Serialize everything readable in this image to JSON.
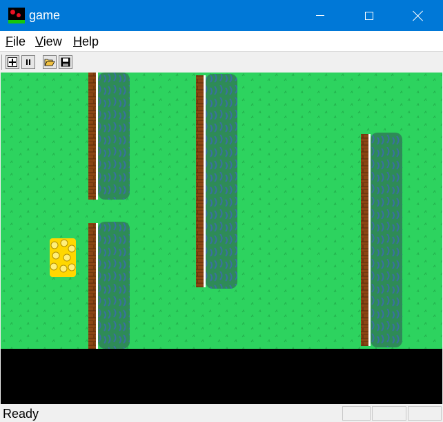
{
  "window": {
    "title": "game",
    "icon": "game-app-icon"
  },
  "menu": {
    "file": {
      "accel": "F",
      "rest": "ile"
    },
    "view": {
      "accel": "V",
      "rest": "iew"
    },
    "help": {
      "accel": "H",
      "rest": "elp"
    }
  },
  "toolbar": {
    "buttons": [
      {
        "name": "new-game-button",
        "icon": "plus-square-icon"
      },
      {
        "name": "pause-button",
        "icon": "pause-icon"
      },
      {
        "name": "open-button",
        "icon": "folder-open-icon"
      },
      {
        "name": "save-button",
        "icon": "floppy-disk-icon"
      }
    ]
  },
  "game": {
    "colors": {
      "grass": "#2dd35f",
      "pipe_wall": "#8b4513",
      "pipe_highlight": "#ffffff",
      "hedge": "#2e8b57",
      "hedge_shade": "#3a6fa0",
      "bird": "#ffd700",
      "empty_area": "#000000"
    },
    "objects": [
      "wall-pipe-1-top",
      "wall-pipe-1-bottom",
      "wall-pipe-2",
      "wall-pipe-3",
      "bird-sprite"
    ]
  },
  "status": {
    "text": "Ready"
  }
}
